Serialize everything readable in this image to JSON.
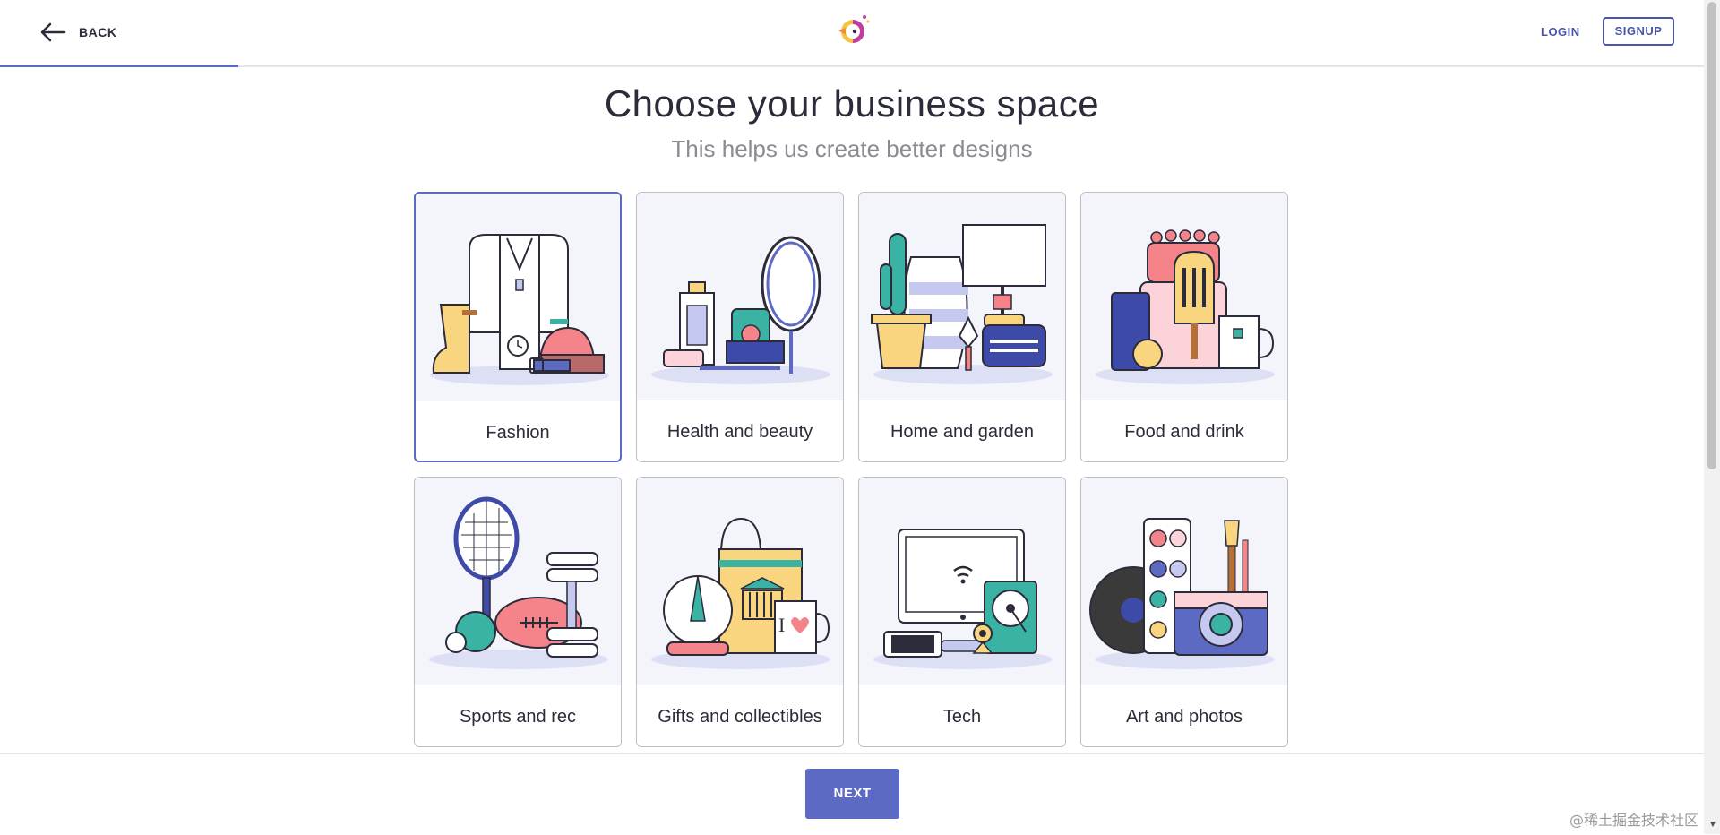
{
  "header": {
    "back_label": "BACK",
    "login_label": "LOGIN",
    "signup_label": "SIGNUP",
    "progress_fraction": 0.14
  },
  "main": {
    "title": "Choose your business space",
    "subtitle": "This helps us create better designs",
    "categories": [
      {
        "label": "Fashion",
        "icon": "fashion-illustration",
        "selected": true
      },
      {
        "label": "Health and beauty",
        "icon": "health-beauty-illustration",
        "selected": false
      },
      {
        "label": "Home and garden",
        "icon": "home-garden-illustration",
        "selected": false
      },
      {
        "label": "Food and drink",
        "icon": "food-drink-illustration",
        "selected": false
      },
      {
        "label": "Sports and rec",
        "icon": "sports-rec-illustration",
        "selected": false
      },
      {
        "label": "Gifts and collectibles",
        "icon": "gifts-collectibles-illustration",
        "selected": false
      },
      {
        "label": "Tech",
        "icon": "tech-illustration",
        "selected": false
      },
      {
        "label": "Art and photos",
        "icon": "art-photos-illustration",
        "selected": false
      }
    ]
  },
  "footer": {
    "next_label": "NEXT"
  },
  "watermark": "@稀土掘金技术社区",
  "colors": {
    "accent": "#5c6ac4",
    "card_bg": "#f4f5fa",
    "border": "#bfc0c7",
    "text": "#2b2b3a",
    "muted": "#8a8b93"
  }
}
